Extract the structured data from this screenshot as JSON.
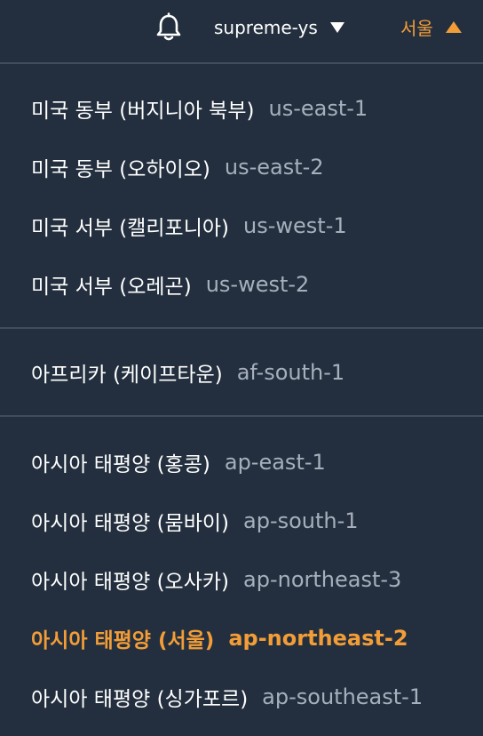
{
  "colors": {
    "background": "#232f3e",
    "divider": "#414d5c",
    "text": "#ffffff",
    "muted": "#a6b0bd",
    "accent": "#f29d38"
  },
  "topbar": {
    "notification_icon": "bell-icon",
    "account_name": "supreme-ys",
    "account_caret_icon": "caret-down-icon",
    "region_label": "서울",
    "region_caret_icon": "caret-up-icon"
  },
  "regions": {
    "group1": [
      {
        "name": "미국 동부 (버지니아 북부)",
        "code": "us-east-1"
      },
      {
        "name": "미국 동부 (오하이오)",
        "code": "us-east-2"
      },
      {
        "name": "미국 서부 (캘리포니아)",
        "code": "us-west-1"
      },
      {
        "name": "미국 서부 (오레곤)",
        "code": "us-west-2"
      }
    ],
    "group2": [
      {
        "name": "아프리카 (케이프타운)",
        "code": "af-south-1"
      }
    ],
    "group3": [
      {
        "name": "아시아 태평양 (홍콩)",
        "code": "ap-east-1"
      },
      {
        "name": "아시아 태평양 (뭄바이)",
        "code": "ap-south-1"
      },
      {
        "name": "아시아 태평양 (오사카)",
        "code": "ap-northeast-3"
      },
      {
        "name": "아시아 태평양 (서울)",
        "code": "ap-northeast-2",
        "selected": true
      },
      {
        "name": "아시아 태평양 (싱가포르)",
        "code": "ap-southeast-1"
      }
    ]
  }
}
